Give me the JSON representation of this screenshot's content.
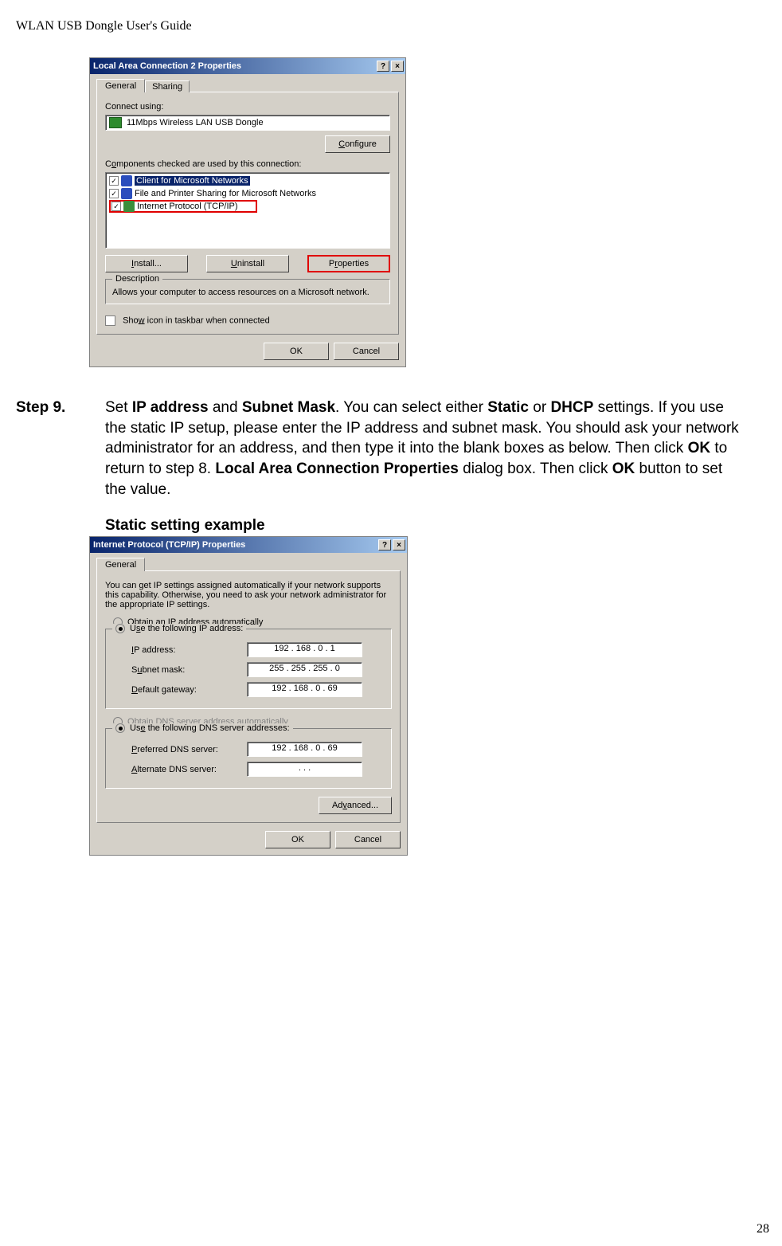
{
  "header": "WLAN USB Dongle User's Guide",
  "page_number": "28",
  "dialog1": {
    "title": "Local Area Connection 2 Properties",
    "help_btn": "?",
    "close_btn": "×",
    "tab_general": "General",
    "tab_sharing": "Sharing",
    "connect_using_lbl": "Connect using:",
    "device": "11Mbps Wireless LAN USB Dongle",
    "configure_btn": "Configure",
    "components_lbl": "Components checked are used by this connection:",
    "comp1": "Client for Microsoft Networks",
    "comp2": "File and Printer Sharing for Microsoft Networks",
    "comp3": "Internet Protocol (TCP/IP)",
    "install_btn": "Install...",
    "uninstall_btn": "Uninstall",
    "properties_btn": "Properties",
    "description_legend": "Description",
    "description_text": "Allows your computer to access resources on a Microsoft network.",
    "show_icon": "Show icon in taskbar when connected",
    "ok": "OK",
    "cancel": "Cancel"
  },
  "step9": {
    "label": "Step 9.",
    "set": "Set ",
    "ip": "IP address",
    "and": " and ",
    "subnet": "Subnet Mask",
    "t1": ". You can select either ",
    "static": "Static",
    "or": " or ",
    "dhcp": "DHCP",
    "t2": "settings. If you use the static IP setup, please enter the IP address and subnet mask. You should ask your network administrator for an address, and then type it into the blank boxes as below. Then click ",
    "ok": "OK",
    "t3": " to return to step 8. ",
    "lacp": "Local Area Connection Properties",
    "t4": " dialog box. Then click ",
    "ok2": "OK",
    "t5": " button to set the value."
  },
  "static_heading": "Static setting example",
  "dialog2": {
    "title": "Internet Protocol (TCP/IP) Properties",
    "tab_general": "General",
    "intro": "You can get IP settings assigned automatically if your network supports this capability. Otherwise, you need to ask your network administrator for the appropriate IP settings.",
    "obtain_ip": "Obtain an IP address automatically",
    "use_ip": "Use the following IP address:",
    "ip_lbl": "IP address:",
    "ip_val": "192 . 168 .   0   .   1",
    "subnet_lbl": "Subnet mask:",
    "subnet_val": "255 . 255 . 255 .   0",
    "gateway_lbl": "Default gateway:",
    "gateway_val": "192 . 168 .   0   .  69",
    "obtain_dns": "Obtain DNS server address automatically",
    "use_dns": "Use the following DNS server addresses:",
    "pref_dns_lbl": "Preferred DNS server:",
    "pref_dns_val": "192 . 168 .   0   .  69",
    "alt_dns_lbl": "Alternate DNS server:",
    "alt_dns_val": ".        .       .",
    "advanced": "Advanced...",
    "ok": "OK",
    "cancel": "Cancel"
  }
}
